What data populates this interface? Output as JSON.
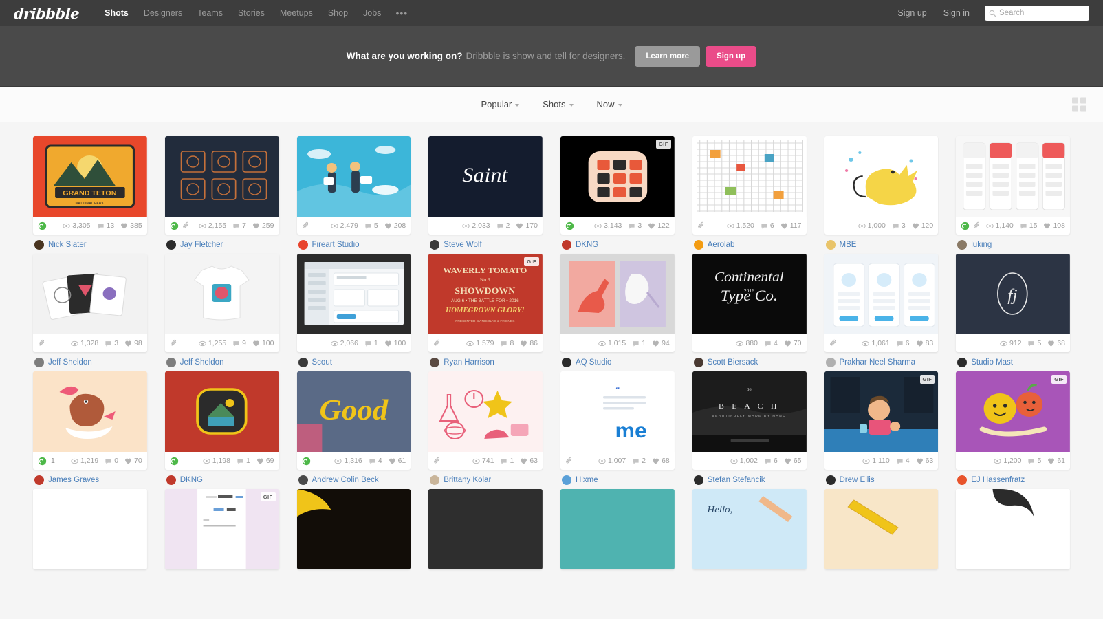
{
  "header": {
    "logo": "dribbble",
    "nav": [
      {
        "label": "Shots",
        "active": true
      },
      {
        "label": "Designers",
        "active": false
      },
      {
        "label": "Teams",
        "active": false
      },
      {
        "label": "Stories",
        "active": false
      },
      {
        "label": "Meetups",
        "active": false
      },
      {
        "label": "Shop",
        "active": false
      },
      {
        "label": "Jobs",
        "active": false
      }
    ],
    "more_icon": "•••",
    "sign_up": "Sign up",
    "sign_in": "Sign in",
    "search_placeholder": "Search",
    "search_value": ""
  },
  "promo": {
    "headline": "What are you working on?",
    "subtext": "Dribbble is show and tell for designers.",
    "learn_more": "Learn more",
    "sign_up": "Sign up"
  },
  "filters": [
    {
      "label": "Popular"
    },
    {
      "label": "Shots"
    },
    {
      "label": "Now"
    }
  ],
  "colors": {
    "accent_pink": "#ea4c89",
    "nav_bg": "#3d3d3d",
    "promo_bg": "#4a4a4a",
    "page_bg": "#f5f5f5",
    "link_blue": "#4a7fba",
    "rebound_green": "#4db848"
  },
  "shots": [
    {
      "id": "s1",
      "author": "Nick Slater",
      "avatar_bg": "#4a3520",
      "views": "3,305",
      "comments": "13",
      "likes": "385",
      "rebound": true,
      "attachment": false,
      "gif": false,
      "art": "grand-teton",
      "thumb_bg": "#e8472b"
    },
    {
      "id": "s2",
      "author": "Jay Fletcher",
      "avatar_bg": "#2b2b2b",
      "views": "2,155",
      "comments": "7",
      "likes": "259",
      "rebound": true,
      "attachment": true,
      "gif": false,
      "art": "badges-dark",
      "thumb_bg": "#222c3c"
    },
    {
      "id": "s3",
      "author": "Fireart Studio",
      "avatar_bg": "#e8432c",
      "views": "2,479",
      "comments": "5",
      "likes": "208",
      "rebound": false,
      "attachment": true,
      "gif": false,
      "art": "team-illustration",
      "thumb_bg": "#3cb6d9"
    },
    {
      "id": "s4",
      "author": "Steve Wolf",
      "avatar_bg": "#3a3a3a",
      "views": "2,033",
      "comments": "2",
      "likes": "170",
      "rebound": false,
      "attachment": false,
      "gif": false,
      "art": "saint-script",
      "thumb_bg": "#141c2e"
    },
    {
      "id": "s5",
      "author": "DKNG",
      "avatar_bg": "#c0392b",
      "views": "3,143",
      "comments": "3",
      "likes": "122",
      "rebound": true,
      "attachment": false,
      "gif": true,
      "art": "app-icon-grid",
      "thumb_bg": "#000000"
    },
    {
      "id": "s6",
      "author": "Aerolab",
      "avatar_bg": "#f39c12",
      "views": "1,520",
      "comments": "6",
      "likes": "117",
      "rebound": false,
      "attachment": true,
      "gif": false,
      "art": "city-map-line",
      "thumb_bg": "#ffffff"
    },
    {
      "id": "s7",
      "author": "MBE",
      "avatar_bg": "#e9c46a",
      "views": "1,000",
      "comments": "3",
      "likes": "120",
      "rebound": false,
      "attachment": false,
      "gif": false,
      "art": "unicorn",
      "thumb_bg": "#ffffff"
    },
    {
      "id": "s8",
      "author": "luking",
      "avatar_bg": "#8a7a66",
      "views": "1,140",
      "comments": "15",
      "likes": "108",
      "rebound": true,
      "attachment": true,
      "gif": false,
      "art": "app-screens-red",
      "thumb_bg": "#f7f7f7"
    },
    {
      "id": "s9",
      "author": "Jeff Sheldon",
      "avatar_bg": "#7d7d7d",
      "views": "1,328",
      "comments": "3",
      "likes": "98",
      "rebound": false,
      "attachment": true,
      "gif": false,
      "art": "cards-fan",
      "thumb_bg": "#f2f2f2"
    },
    {
      "id": "s10",
      "author": "Jeff Sheldon",
      "avatar_bg": "#7d7d7d",
      "views": "1,255",
      "comments": "9",
      "likes": "100",
      "rebound": false,
      "attachment": true,
      "gif": false,
      "art": "tshirt",
      "thumb_bg": "#f4f4f4"
    },
    {
      "id": "s11",
      "author": "Scout",
      "avatar_bg": "#3a3a3a",
      "views": "2,066",
      "comments": "1",
      "likes": "100",
      "rebound": false,
      "attachment": false,
      "gif": false,
      "art": "desktop-ui",
      "thumb_bg": "#2b2b2b"
    },
    {
      "id": "s12",
      "author": "Ryan Harrison",
      "avatar_bg": "#5a4a42",
      "views": "1,579",
      "comments": "8",
      "likes": "86",
      "rebound": false,
      "attachment": true,
      "gif": true,
      "art": "waverly-poster",
      "thumb_bg": "#c0392b"
    },
    {
      "id": "s13",
      "author": "AQ Studio",
      "avatar_bg": "#2b2b2b",
      "views": "1,015",
      "comments": "1",
      "likes": "94",
      "rebound": false,
      "attachment": false,
      "gif": false,
      "art": "shoe-diptych",
      "thumb_bg": "#d8d8d8"
    },
    {
      "id": "s14",
      "author": "Scott Biersack",
      "avatar_bg": "#4a3a32",
      "views": "880",
      "comments": "4",
      "likes": "70",
      "rebound": false,
      "attachment": false,
      "gif": false,
      "art": "continental-type",
      "thumb_bg": "#0a0a0a"
    },
    {
      "id": "s15",
      "author": "Prakhar Neel Sharma",
      "avatar_bg": "#b0b0b0",
      "views": "1,061",
      "comments": "6",
      "likes": "83",
      "rebound": false,
      "attachment": true,
      "gif": false,
      "art": "mobile-screens-blue",
      "thumb_bg": "#f0f4f8"
    },
    {
      "id": "s16",
      "author": "Studio Mast",
      "avatar_bg": "#2b2b2b",
      "views": "912",
      "comments": "5",
      "likes": "68",
      "rebound": false,
      "attachment": false,
      "gif": false,
      "art": "monogram-fj",
      "thumb_bg": "#2c3444"
    },
    {
      "id": "s17",
      "author": "James Graves",
      "avatar_bg": "#c0392b",
      "views": "1,219",
      "comments": "0",
      "likes": "70",
      "rebound": true,
      "rebound_count": "1",
      "attachment": false,
      "gif": false,
      "art": "bird-bowl",
      "thumb_bg": "#fbe3c8"
    },
    {
      "id": "s18",
      "author": "DKNG",
      "avatar_bg": "#c0392b",
      "views": "1,198",
      "comments": "1",
      "likes": "69",
      "rebound": true,
      "attachment": false,
      "gif": false,
      "art": "house-badge",
      "thumb_bg": "#c0392b"
    },
    {
      "id": "s19",
      "author": "Andrew Colin Beck",
      "avatar_bg": "#4a4a4a",
      "views": "1,316",
      "comments": "4",
      "likes": "61",
      "rebound": true,
      "attachment": false,
      "gif": false,
      "art": "rug-lettering",
      "thumb_bg": "#5a6a86"
    },
    {
      "id": "s20",
      "author": "Brittany Kolar",
      "avatar_bg": "#c9b59a",
      "views": "741",
      "comments": "1",
      "likes": "63",
      "rebound": false,
      "attachment": true,
      "gif": false,
      "art": "science-icons",
      "thumb_bg": "#fdf1f1"
    },
    {
      "id": "s21",
      "author": "Hixme",
      "avatar_bg": "#5aa0d8",
      "views": "1,007",
      "comments": "2",
      "likes": "68",
      "rebound": false,
      "attachment": true,
      "gif": false,
      "art": "me-quote",
      "thumb_bg": "#ffffff"
    },
    {
      "id": "s22",
      "author": "Stefan Stefancik",
      "avatar_bg": "#2b2b2b",
      "views": "1,002",
      "comments": "6",
      "likes": "65",
      "rebound": false,
      "attachment": false,
      "gif": false,
      "art": "beach-hero",
      "thumb_bg": "#101010"
    },
    {
      "id": "s23",
      "author": "Drew Ellis",
      "avatar_bg": "#2b2b2b",
      "views": "1,110",
      "comments": "4",
      "likes": "63",
      "rebound": false,
      "attachment": false,
      "gif": true,
      "art": "kid-window",
      "thumb_bg": "#1b2a3a"
    },
    {
      "id": "s24",
      "author": "EJ Hassenfratz",
      "avatar_bg": "#e8542c",
      "views": "1,200",
      "comments": "5",
      "likes": "61",
      "rebound": false,
      "attachment": false,
      "gif": true,
      "art": "fruit-characters",
      "thumb_bg": "#a855b8"
    },
    {
      "id": "s25",
      "author": "",
      "avatar_bg": "#cccccc",
      "views": "",
      "comments": "",
      "likes": "",
      "rebound": false,
      "attachment": false,
      "gif": false,
      "art": "partial-white",
      "thumb_bg": "#ffffff"
    },
    {
      "id": "s26",
      "author": "",
      "avatar_bg": "#cccccc",
      "views": "",
      "comments": "",
      "likes": "",
      "rebound": false,
      "attachment": false,
      "gif": true,
      "art": "partial-editor",
      "thumb_bg": "#f0e4f2"
    },
    {
      "id": "s27",
      "author": "",
      "avatar_bg": "#cccccc",
      "views": "",
      "comments": "",
      "likes": "",
      "rebound": false,
      "attachment": false,
      "gif": false,
      "art": "partial-dark-yellow",
      "thumb_bg": "#120d08"
    },
    {
      "id": "s28",
      "author": "",
      "avatar_bg": "#cccccc",
      "views": "",
      "comments": "",
      "likes": "",
      "rebound": false,
      "attachment": false,
      "gif": false,
      "art": "partial-charcoal",
      "thumb_bg": "#2e2e2e"
    },
    {
      "id": "s29",
      "author": "",
      "avatar_bg": "#cccccc",
      "views": "",
      "comments": "",
      "likes": "",
      "rebound": false,
      "attachment": false,
      "gif": false,
      "art": "partial-teal",
      "thumb_bg": "#4fb3b0"
    },
    {
      "id": "s30",
      "author": "",
      "avatar_bg": "#cccccc",
      "views": "",
      "comments": "",
      "likes": "",
      "rebound": false,
      "attachment": false,
      "gif": false,
      "art": "partial-hello",
      "thumb_bg": "#cfe9f7"
    },
    {
      "id": "s31",
      "author": "",
      "avatar_bg": "#cccccc",
      "views": "",
      "comments": "",
      "likes": "",
      "rebound": false,
      "attachment": false,
      "gif": false,
      "art": "partial-pencil",
      "thumb_bg": "#f8e6c8"
    },
    {
      "id": "s32",
      "author": "",
      "avatar_bg": "#cccccc",
      "views": "",
      "comments": "",
      "likes": "",
      "rebound": false,
      "attachment": false,
      "gif": false,
      "art": "partial-face",
      "thumb_bg": "#ffffff"
    }
  ]
}
